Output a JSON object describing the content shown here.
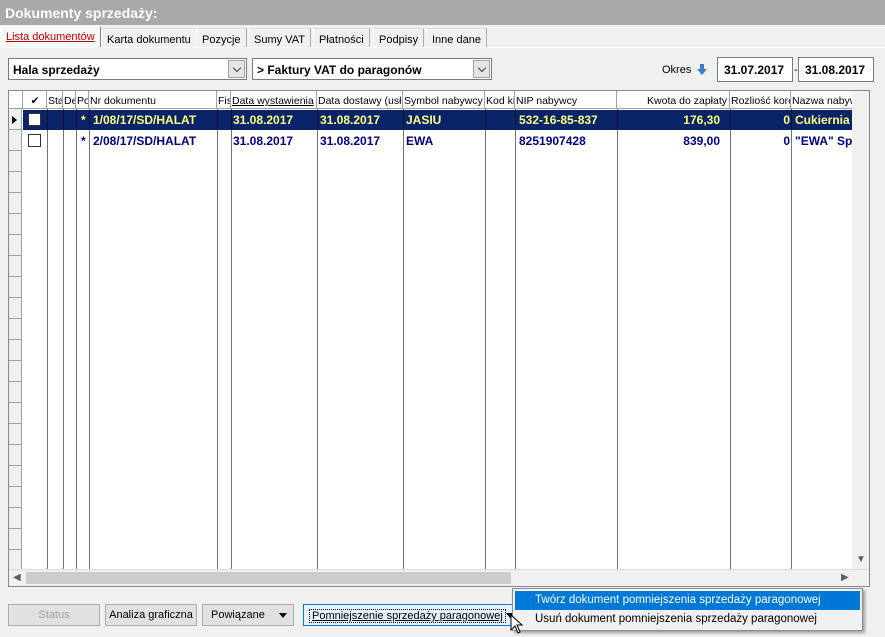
{
  "window": {
    "title": "Dokumenty sprzedaży:"
  },
  "tabs": [
    {
      "label": "Lista dokumentów"
    },
    {
      "label": "Karta dokumentu"
    },
    {
      "label": "Pozycje"
    },
    {
      "label": "Sumy VAT"
    },
    {
      "label": "Płatności"
    },
    {
      "label": "Podpisy"
    },
    {
      "label": "Inne dane"
    }
  ],
  "filters": {
    "location": "Hala sprzedaży",
    "doc_type": "> Faktury VAT do paragonów",
    "period_label": "Okres",
    "date_from": "31.07.2017",
    "date_separator": "-",
    "date_to": "31.08.2017"
  },
  "grid": {
    "headers": [
      "✔",
      "Sta",
      "De",
      "Po",
      "Nr dokumentu",
      "Fis",
      "Data wystawienia",
      "Data dostawy (usł",
      "Symbol nabywcy",
      "Kod ki",
      "NIP nabywcy",
      "Kwota do zapłaty",
      "Rozliość korekt",
      "Nazwa nabyw"
    ],
    "rows": [
      {
        "flag": "*",
        "nr": "1/08/17/SD/HALAT",
        "data_wyst": "31.08.2017",
        "data_dost": "31.08.2017",
        "symbol": "JASIU",
        "nip": "532-16-85-837",
        "kwota": "176,30",
        "korekt": "0",
        "nazwa": "Cukiernia"
      },
      {
        "flag": "*",
        "nr": "2/08/17/SD/HALAT",
        "data_wyst": "31.08.2017",
        "data_dost": "31.08.2017",
        "symbol": "EWA",
        "nip": "8251907428",
        "kwota": "839,00",
        "korekt": "0",
        "nazwa": "\"EWA\" Sp"
      }
    ]
  },
  "buttons": {
    "status": "Status",
    "analiza": "Analiza graficzna",
    "powiazane": "Powiązane",
    "pomniejszenie": "Pomniejszenie sprzedaży paragonowej"
  },
  "popup_menu": [
    {
      "label": "Twórz dokument pomniejszenia sprzedaży paragonowej",
      "highlighted": true
    },
    {
      "label": "Usuń dokument pomniejszenia sprzedaży paragonowej",
      "highlighted": false
    }
  ],
  "icons": {
    "sort": "arrow-down-icon",
    "dropdown": "chevron-down-icon",
    "pointer": "mouse-cursor-icon"
  }
}
